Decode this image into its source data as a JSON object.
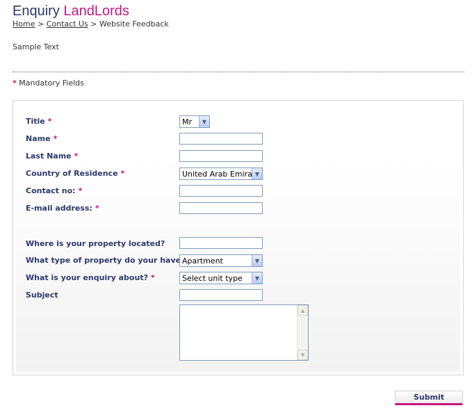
{
  "header": {
    "title_part1": "Enquiry ",
    "title_part2": "LandLords"
  },
  "breadcrumb": {
    "items": [
      "Home",
      "Contact Us",
      "Website Feedback"
    ],
    "separator": ">"
  },
  "intro": {
    "text": "Sample Text"
  },
  "mandatory_note": {
    "star": "*",
    "text": "Mandatory Fields"
  },
  "form": {
    "required_marker": "*",
    "fields": {
      "title": {
        "label": "Title",
        "value": "Mr"
      },
      "name": {
        "label": "Name",
        "value": ""
      },
      "lastname": {
        "label": "Last Name",
        "value": ""
      },
      "country": {
        "label": "Country of Residence",
        "value": "United Arab Emirates"
      },
      "contact": {
        "label": "Contact no:",
        "value": ""
      },
      "email": {
        "label": "E-mail address:",
        "value": ""
      },
      "location": {
        "label": "Where is your property located?",
        "value": ""
      },
      "proptype": {
        "label": "What type of property do your have?",
        "value": "Apartment"
      },
      "enquiry": {
        "label": "What is your enquiry about?",
        "value": "Select unit type"
      },
      "subject": {
        "label": "Subject",
        "value": ""
      },
      "message": {
        "value": ""
      }
    },
    "submit_label": "Submit"
  },
  "colors": {
    "title_navy": "#2b3a6b",
    "brand_pink": "#c8177c",
    "input_border": "#7f9db9"
  }
}
